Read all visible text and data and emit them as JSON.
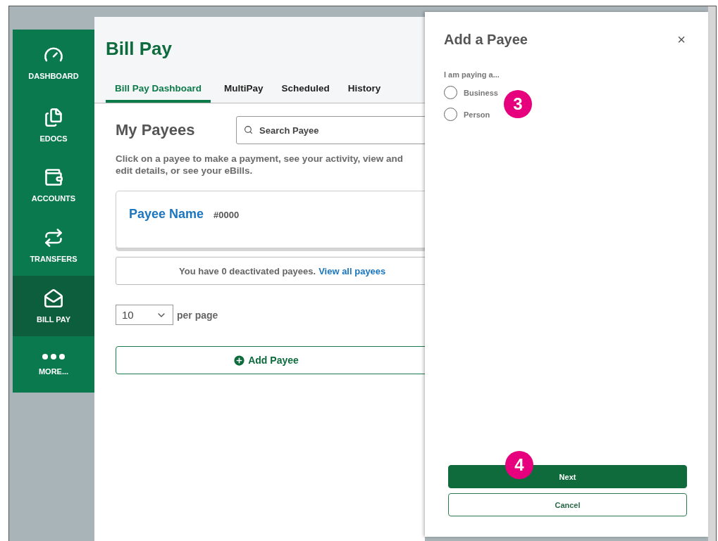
{
  "sidebar": {
    "items": [
      {
        "label": "DASHBOARD",
        "selected": false
      },
      {
        "label": "EDOCS",
        "selected": false
      },
      {
        "label": "ACCOUNTS",
        "selected": false
      },
      {
        "label": "TRANSFERS",
        "selected": false
      },
      {
        "label": "BILL PAY",
        "selected": true
      },
      {
        "label": "MORE...",
        "selected": false
      }
    ]
  },
  "page": {
    "title": "Bill Pay",
    "tabs": [
      {
        "label": "Bill Pay Dashboard",
        "selected": true
      },
      {
        "label": "MultiPay",
        "selected": false
      },
      {
        "label": "Scheduled",
        "selected": false
      },
      {
        "label": "History",
        "selected": false
      }
    ],
    "section_title": "My Payees",
    "search": {
      "placeholder": "Search Payee"
    },
    "description": "Click on a payee to make a payment, see your activity, view and edit details, or see your eBills.",
    "payees": [
      {
        "name": "Payee Name",
        "number": "#0000"
      }
    ],
    "deactivated": {
      "text": "You have 0 deactivated payees.",
      "link": "View all payees"
    },
    "per_page": {
      "value": "10",
      "label": "per page"
    },
    "add_button": "Add Payee"
  },
  "dialog": {
    "title": "Add a Payee",
    "close": "×",
    "question": "I am paying a...",
    "options": [
      {
        "label": "Business",
        "selected": false
      },
      {
        "label": "Person",
        "selected": false
      }
    ],
    "buttons": [
      {
        "label": "Next",
        "kind": "primary"
      },
      {
        "label": "Cancel",
        "kind": "secondary"
      }
    ]
  },
  "callouts": [
    {
      "label": "3"
    },
    {
      "label": "4"
    }
  ]
}
